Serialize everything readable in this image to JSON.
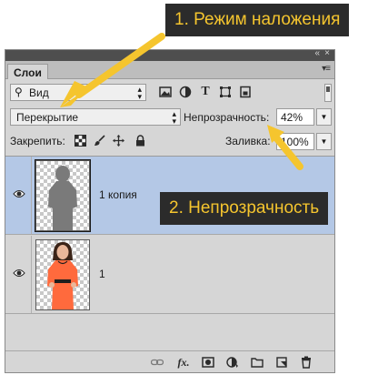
{
  "panel": {
    "collapse_glyph": "«",
    "close_glyph": "×",
    "menu_glyph": "▾≡",
    "tab_label": "Слои"
  },
  "filter": {
    "kind_value": "Вид",
    "icons": [
      "image-filter-icon",
      "adjustment-filter-icon",
      "type-filter-icon",
      "shape-filter-icon",
      "smart-object-filter-icon"
    ]
  },
  "blend": {
    "mode_value": "Перекрытие",
    "opacity_label": "Непрозрачность:",
    "opacity_value": "42%"
  },
  "lock": {
    "label": "Закрепить:",
    "icons": [
      "lock-transparent-icon",
      "lock-paint-icon",
      "lock-position-icon",
      "lock-all-icon"
    ],
    "fill_label": "Заливка:",
    "fill_value": "100%"
  },
  "layers": [
    {
      "name": "1 копия",
      "selected": true,
      "visible": true
    },
    {
      "name": "1",
      "selected": false,
      "visible": true
    }
  ],
  "footer": {
    "icons": [
      "link-layers-icon",
      "fx-icon",
      "mask-icon",
      "adjustment-layer-icon",
      "group-folder-icon",
      "new-layer-icon",
      "trash-icon"
    ]
  },
  "annotations": {
    "callout_1": "1. Режим наложения",
    "callout_2": "2. Непрозрачность"
  },
  "colors": {
    "callout_bg": "#2b2b2b",
    "callout_text": "#f5c52e",
    "arrow": "#f5c52e",
    "selected_layer": "#b4c8e6",
    "dress": "#ff6a3d"
  }
}
